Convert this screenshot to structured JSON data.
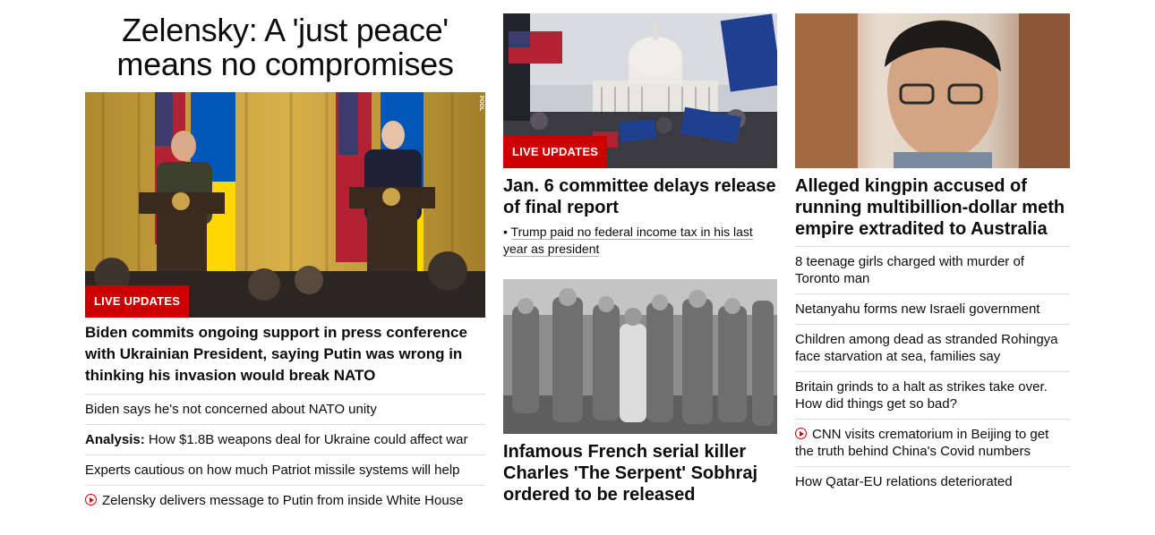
{
  "col1": {
    "headline": "Zelensky: A 'just peace' means no compromises",
    "image_badge": "LIVE UPDATES",
    "image_watermark": "POOL",
    "lead_title": "Biden commits ongoing support in press conference with Ukrainian President, saying Putin was wrong in thinking his invasion would break NATO",
    "items": [
      {
        "text": "Biden says he's not concerned about NATO unity"
      },
      {
        "prefix": "Analysis:",
        "text": "How $1.8B weapons deal for Ukraine could affect war"
      },
      {
        "text": "Experts cautious on how much Patriot missile systems will help"
      },
      {
        "text": "Zelensky delivers message to Putin from inside White House",
        "icon": "play-icon"
      }
    ]
  },
  "col2": {
    "story1": {
      "badge": "LIVE UPDATES",
      "title": "Jan. 6 committee delays release of final report",
      "bullet": "Trump paid no federal income tax in his last year as president"
    },
    "story2": {
      "title": "Infamous French serial killer Charles 'The Serpent' Sobhraj ordered to be released"
    }
  },
  "col3": {
    "title": "Alleged kingpin accused of running multibillion-dollar meth empire extradited to Australia",
    "items": [
      {
        "text": "8 teenage girls charged with murder of Toronto man"
      },
      {
        "text": "Netanyahu forms new Israeli government"
      },
      {
        "text": "Children among dead as stranded Rohingya face starvation at sea, families say"
      },
      {
        "text": "Britain grinds to a halt as strikes take over. How did things get so bad?"
      },
      {
        "text": "CNN visits crematorium in Beijing to get the truth behind China's Covid numbers",
        "icon": "play-icon"
      },
      {
        "text": "How Qatar-EU relations deteriorated"
      }
    ]
  },
  "colors": {
    "accent": "#cc0000",
    "divider": "#dedede"
  }
}
